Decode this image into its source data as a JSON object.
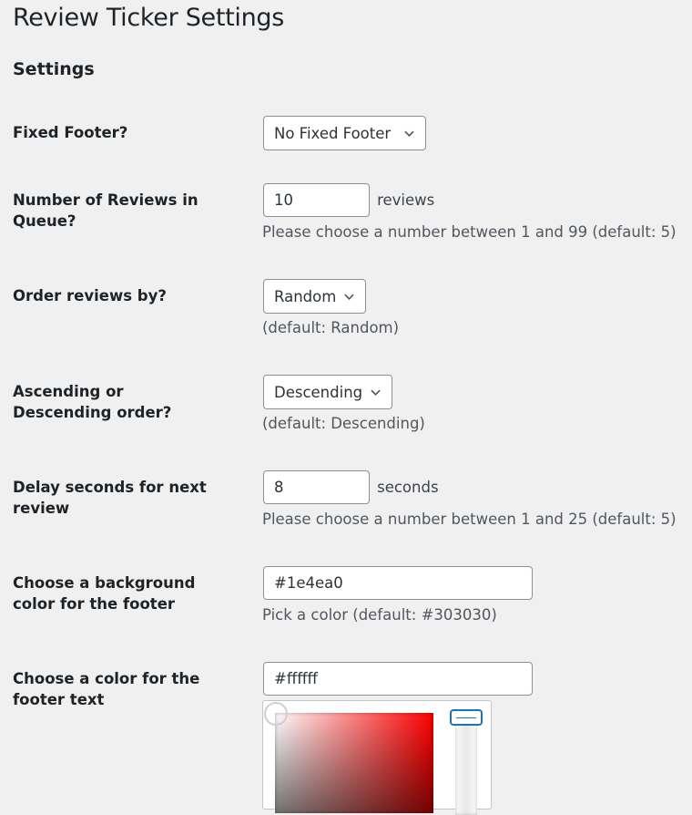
{
  "page": {
    "title": "Review Ticker Settings",
    "section_title": "Settings"
  },
  "settings": {
    "fixed_footer": {
      "label": "Fixed Footer?",
      "selected": "No Fixed Footer"
    },
    "reviews_in_queue": {
      "label": "Number of Reviews in Queue?",
      "value": "10",
      "suffix": "reviews",
      "description": "Please choose a number between 1 and 99 (default: 5)"
    },
    "order_by": {
      "label": "Order reviews by?",
      "selected": "Random",
      "description": "(default: Random)"
    },
    "sort_direction": {
      "label": "Ascending or Descending order?",
      "selected": "Descending",
      "description": "(default: Descending)"
    },
    "delay_seconds": {
      "label": "Delay seconds for next review",
      "value": "8",
      "suffix": "seconds",
      "description": "Please choose a number between 1 and 25 (default: 5)"
    },
    "background_color": {
      "label": "Choose a background color for the footer",
      "value": "#1e4ea0",
      "description": "Pick a color (default: #303030)"
    },
    "text_color": {
      "label": "Choose a color for the footer text",
      "value": "#ffffff",
      "picker_hue_color": "#ff0000",
      "picker_handle_color": "#2271b1"
    }
  }
}
